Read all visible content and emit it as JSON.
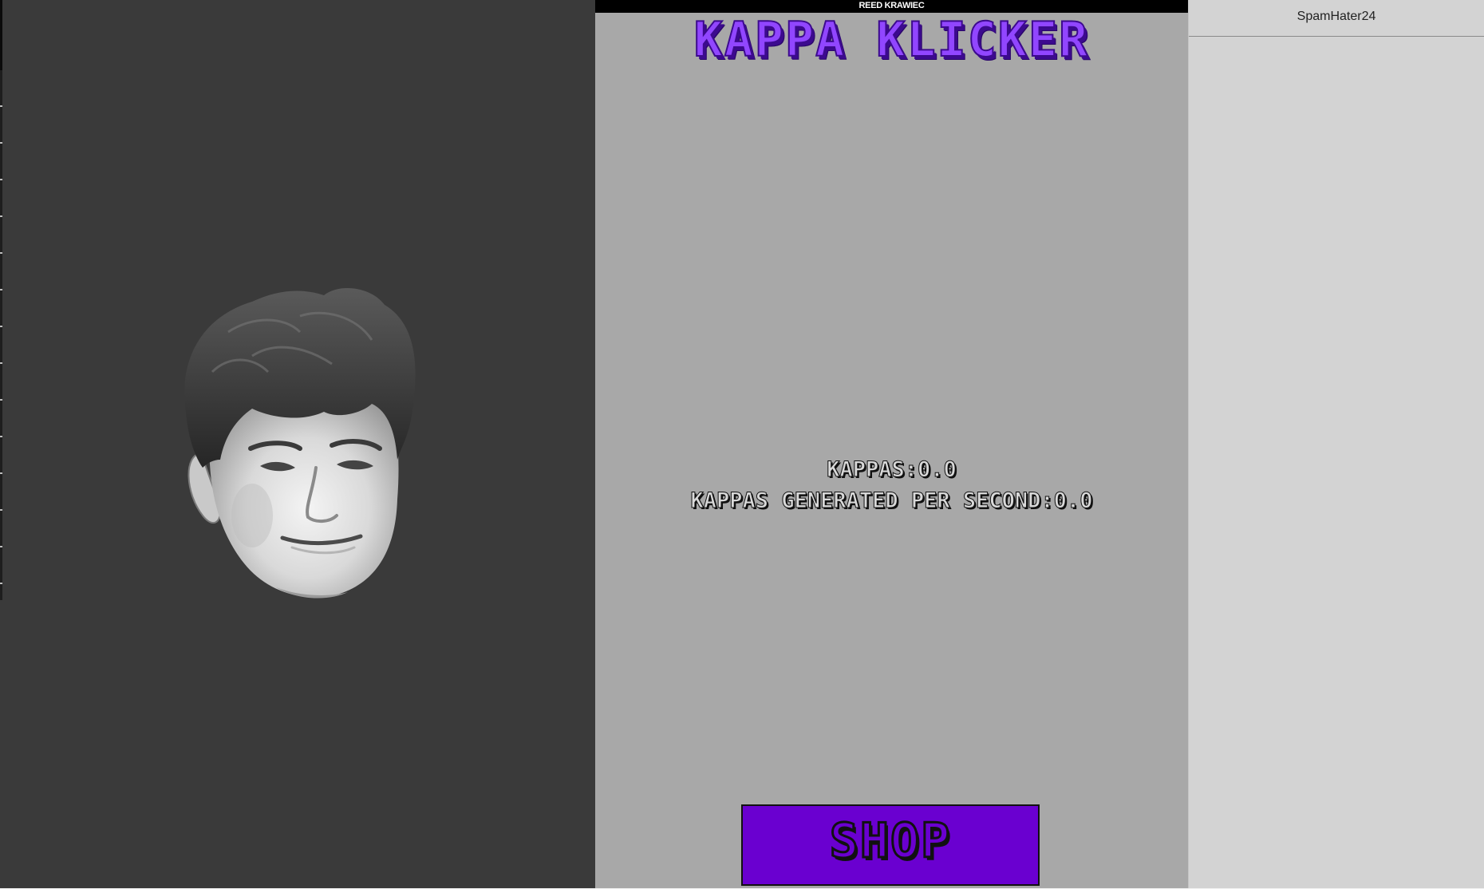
{
  "header": {
    "author": "REED KRAWIEC",
    "title": "KAPPA KLICKER"
  },
  "stats": {
    "kappas": "KAPPAS:0.0",
    "per_second": "KAPPAS GENERATED PER SECOND:0.0"
  },
  "shop": {
    "label": "SHOP"
  },
  "sidebar": {
    "username": "SpamHater24"
  },
  "colors": {
    "left_panel": "#3a3a3a",
    "center_panel": "#a8a8a8",
    "right_panel": "#d3d3d3",
    "title_purple": "#9146ff",
    "shop_purple": "#6a00d0"
  },
  "icons": {
    "clicker": "kappa-face-icon"
  }
}
